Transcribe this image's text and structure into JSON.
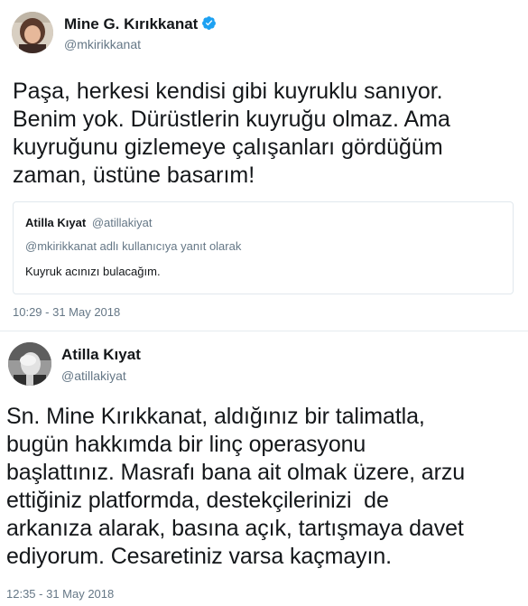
{
  "tweets": [
    {
      "author_name": "Mine G. Kırıkkanat",
      "handle": "@mkirikkanat",
      "verified": true,
      "text": "Paşa, herkesi kendisi gibi kuyruklu sanıyor.\nBenim yok. Dürüstlerin kuyruğu olmaz. Ama\nkuyruğunu gizlemeye çalışanları gördüğüm\nzaman, üstüne basarım!",
      "quote": {
        "author_name": "Atilla Kıyat",
        "handle": "@atillakiyat",
        "reply_context": "@mkirikkanat adlı kullanıcıya yanıt olarak",
        "text": "Kuyruk acınızı bulacağım."
      },
      "timestamp": "10:29 - 31 May 2018"
    },
    {
      "author_name": "Atilla Kıyat",
      "handle": "@atillakiyat",
      "verified": false,
      "text": "Sn. Mine Kırıkkanat, aldığınız bir talimatla,\nbugün hakkımda bir linç operasyonu\nbaşlattınız. Masrafı bana ait olmak üzere, arzu\nettiğiniz platformda, destekçilerinizi  de\narkanıza alarak, basına açık, tartışmaya davet\nediyorum. Cesaretiniz varsa kaçmayın.",
      "timestamp": "12:35 - 31 May 2018"
    }
  ],
  "colors": {
    "verified_badge": "#1da1f2",
    "secondary_text": "#657786",
    "primary_text": "#14171a"
  }
}
